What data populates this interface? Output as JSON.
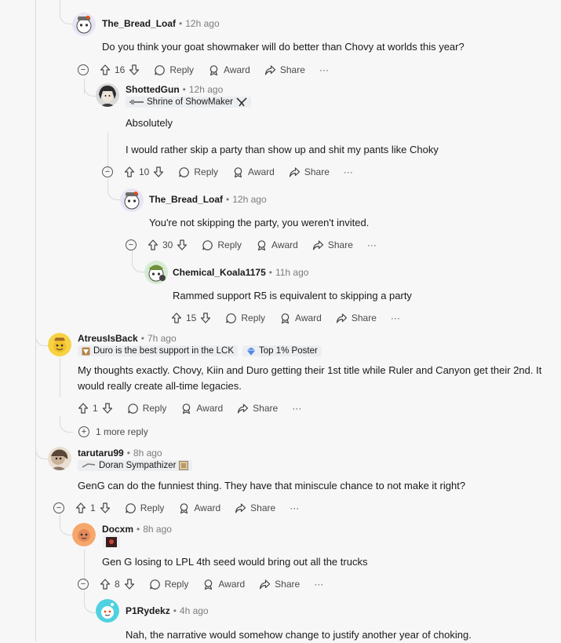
{
  "comments": [
    {
      "id": "c1",
      "user": "The_Bread_Loaf",
      "time": "12h ago",
      "text": [
        "Do you think your goat showmaker will do better than Chovy at worlds this year?"
      ],
      "score": "16",
      "collapsible": true
    },
    {
      "id": "c2",
      "user": "ShottedGun",
      "time": "12h ago",
      "flair": "Shrine of ShowMaker",
      "text": [
        "Absolutely",
        "I would rather skip a party than show up and shit my pants like Choky"
      ],
      "score": "10",
      "collapsible": true
    },
    {
      "id": "c3",
      "user": "The_Bread_Loaf",
      "time": "12h ago",
      "text": [
        "You're not skipping the party, you weren't invited."
      ],
      "score": "30",
      "collapsible": true
    },
    {
      "id": "c4",
      "user": "Chemical_Koala1175",
      "time": "11h ago",
      "text": [
        "Rammed support R5 is equivalent to skipping a party"
      ],
      "score": "15",
      "collapsible": false
    },
    {
      "id": "c5",
      "user": "AtreusIsBack",
      "time": "7h ago",
      "flair": "Duro is the best support in the LCK",
      "flair2": "Top 1% Poster",
      "text": [
        "My thoughts exactly. Chovy, Kiin and Duro getting their 1st title while Ruler and Canyon get their 2nd. It would really create all-time legacies."
      ],
      "score": "1",
      "collapsible": false,
      "more_replies": "1 more reply"
    },
    {
      "id": "c6",
      "user": "tarutaru99",
      "time": "8h ago",
      "flair": "Doran Sympathizer",
      "text": [
        "GenG can do the funniest thing. They have that miniscule chance to not make it right?"
      ],
      "score": "1",
      "collapsible": true
    },
    {
      "id": "c7",
      "user": "Docxm",
      "time": "8h ago",
      "text": [
        "Gen G losing to LPL 4th seed would bring out all the trucks"
      ],
      "score": "8",
      "collapsible": true
    },
    {
      "id": "c8",
      "user": "P1Rydekz",
      "time": "4h ago",
      "text": [
        "Nah, the narrative would somehow change to justify another year of choking."
      ]
    }
  ],
  "actions": {
    "reply": "Reply",
    "award": "Award",
    "share": "Share",
    "more": "···"
  },
  "meta_separator": "•",
  "colors": {
    "accent": "#1a1a1b",
    "muted": "#7c7c7c",
    "thread_line": "#d8dadd",
    "background": "#f7f7f8"
  }
}
